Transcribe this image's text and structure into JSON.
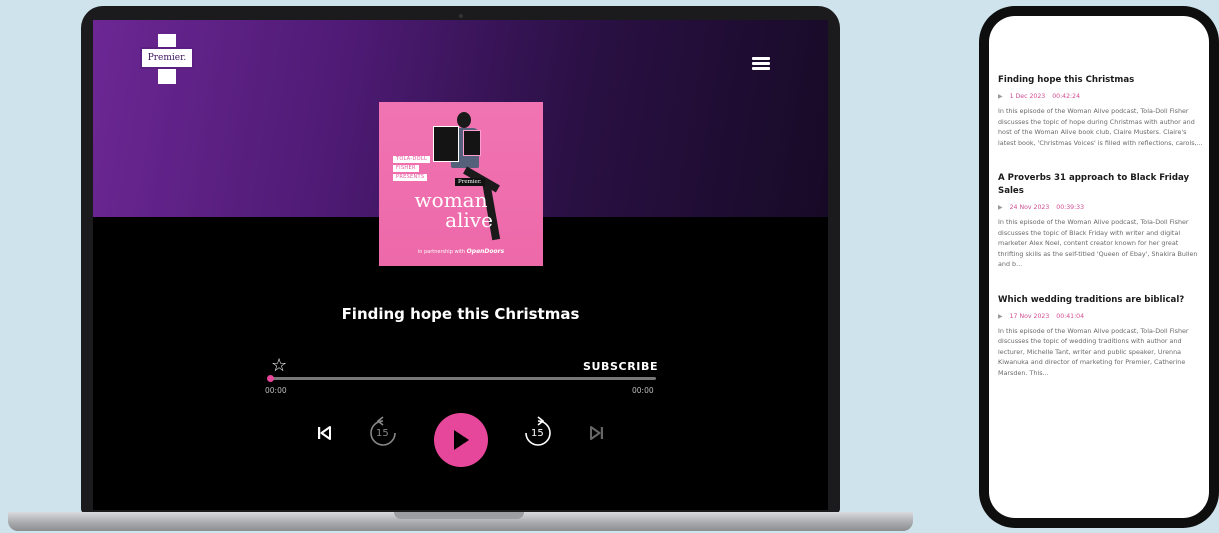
{
  "player": {
    "logo_text": "Premier.",
    "cover": {
      "tag_lines": [
        "TOLA-DOLL",
        "FISHER",
        "PRESENTS"
      ],
      "premier_tag": "Premier.",
      "title_line1": "woman",
      "title_line2": "alive",
      "partner_prefix": "in partnership with",
      "partner_name": "OpenDoors"
    },
    "episode_title": "Finding hope this Christmas",
    "subscribe_label": "SUBSCRIBE",
    "time_current": "00:00",
    "time_total": "00:00",
    "progress_fraction": 0.0,
    "rewind_seconds": "15",
    "forward_seconds": "15",
    "accent_color": "#e7479a"
  },
  "episodes": [
    {
      "title": "Finding hope this Christmas",
      "date": "1 Dec 2023",
      "duration": "00:42:24",
      "description": "In this episode of the Woman Alive podcast, Tola-Doll Fisher discusses the topic of hope during Christmas with author and host of the Woman Alive book club, Claire Musters. Claire's latest book, 'Christmas Voices' is filled with reflections, carols,..."
    },
    {
      "title": "A Proverbs 31 approach to Black Friday Sales",
      "date": "24 Nov 2023",
      "duration": "00:39:33",
      "description": "In this episode of the Woman Alive podcast, Tola-Doll Fisher discusses the topic of Black Friday with writer and digital marketer Alex Noel, content creator known for her great thrifting skills as the self-titled 'Queen of Ebay', Shakira Bullen and b..."
    },
    {
      "title": "Which wedding traditions are biblical?",
      "date": "17 Nov 2023",
      "duration": "00:41:04",
      "description": "In this episode of the Woman Alive podcast, Tola-Doll Fisher discusses the topic of wedding traditions with author and lecturer, Michelle Tant, writer and public speaker, Urenna Kiwanuka and director of marketing for Premier, Catherine Marsden. This..."
    }
  ]
}
